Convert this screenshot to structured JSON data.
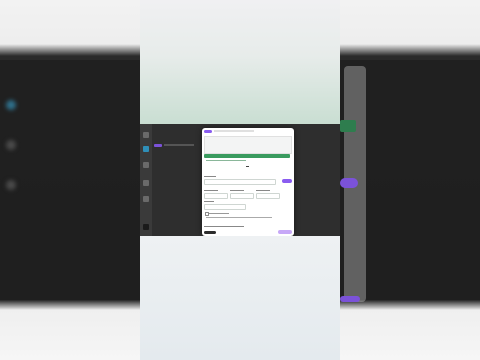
{
  "colors": {
    "accent_green": "#3a9b5f",
    "accent_purple": "#8a5cf0",
    "background_dark": "#2e2e2e",
    "dialog_bg": "#ffffff"
  },
  "dialog": {
    "tag_label": "",
    "title": "",
    "upload_button_label": "",
    "link_section_label": "",
    "add_button_label": "",
    "columns": [
      {
        "label": "",
        "value": ""
      },
      {
        "label": "",
        "value": ""
      },
      {
        "label": "",
        "value": ""
      }
    ],
    "field_label": "",
    "field_value": "",
    "checkbox_label": "",
    "footer_text": ""
  },
  "icons": [
    "close-icon",
    "drag-handle-icon"
  ]
}
